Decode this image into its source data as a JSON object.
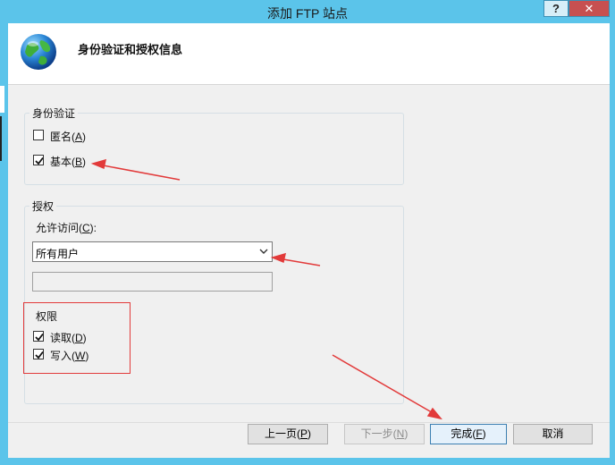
{
  "window": {
    "title": "添加 FTP 站点",
    "help_label": "?",
    "close_label": "✕"
  },
  "header": {
    "title": "身份验证和授权信息",
    "icon": "globe-icon"
  },
  "authentication": {
    "legend": "身份验证",
    "anonymous": {
      "label": "匿名(",
      "key": "A",
      "suffix": ")",
      "checked": false
    },
    "basic": {
      "label": "基本(",
      "key": "B",
      "suffix": ")",
      "checked": true
    }
  },
  "authorization": {
    "legend": "授权",
    "allow_access_label": "允许访问(",
    "allow_access_key": "C",
    "allow_access_suffix": "):",
    "allow_access_value": "所有用户",
    "permissions": {
      "legend": "权限",
      "read": {
        "label": "读取(",
        "key": "D",
        "suffix": ")",
        "checked": true
      },
      "write": {
        "label": "写入(",
        "key": "W",
        "suffix": ")",
        "checked": true
      }
    }
  },
  "buttons": {
    "previous": {
      "label": "上一页(",
      "key": "P",
      "suffix": ")"
    },
    "next": {
      "label": "下一步(",
      "key": "N",
      "suffix": ")"
    },
    "finish": {
      "label": "完成(",
      "key": "F",
      "suffix": ")"
    },
    "cancel": {
      "label": "取消"
    }
  },
  "colors": {
    "titlebar": "#5bc4ea",
    "annotation_red": "#e23a3a"
  }
}
